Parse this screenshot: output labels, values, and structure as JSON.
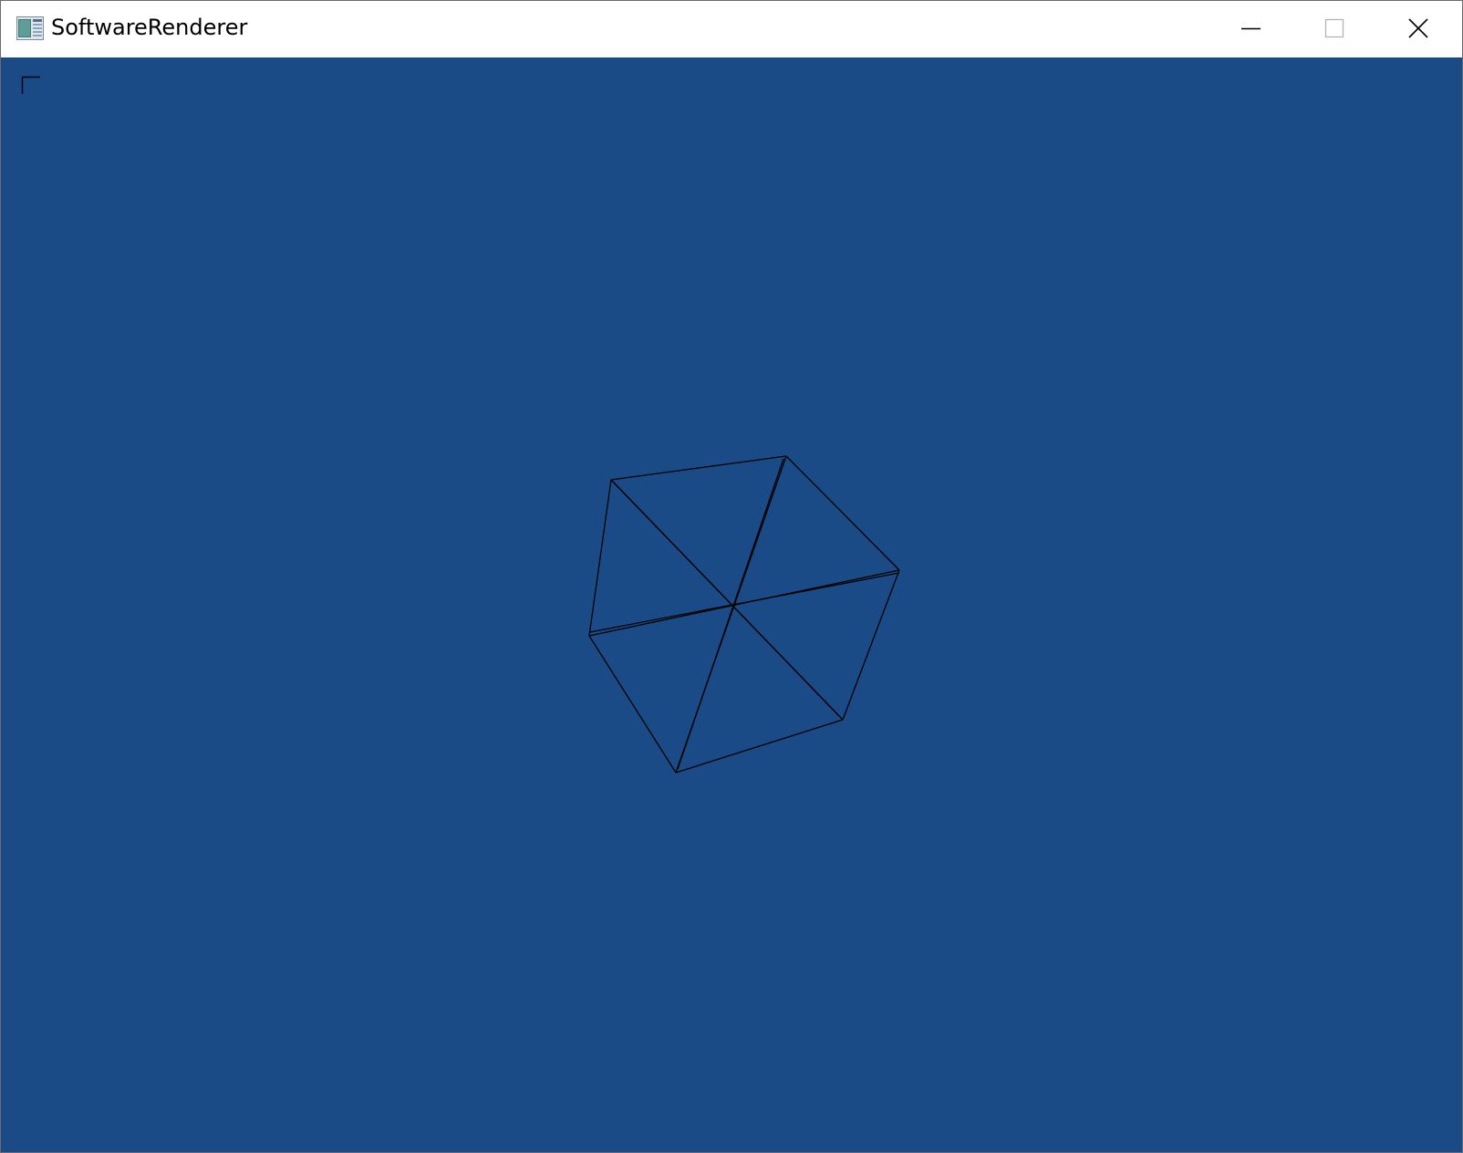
{
  "window": {
    "title": "SoftwareRenderer",
    "icon": "application-window-icon",
    "caption_buttons": [
      "minimize-icon",
      "maximize-icon",
      "close-icon"
    ]
  },
  "viewport": {
    "background_color": "#1b4b87",
    "line_color": "#000000",
    "corner_marker": "top-left-corner-icon",
    "render_mode": "wireframe",
    "model": "cube"
  }
}
